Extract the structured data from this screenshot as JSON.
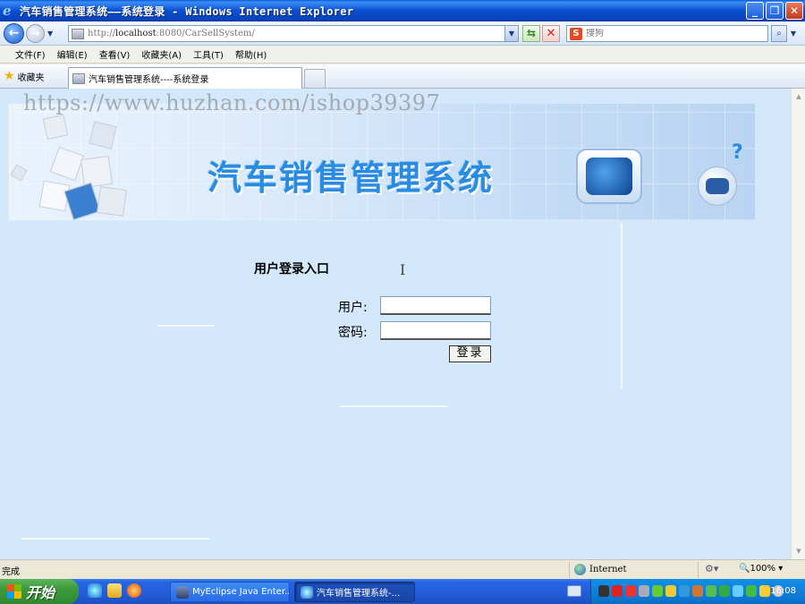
{
  "window": {
    "title": "汽车销售管理系统——系统登录 - Windows Internet Explorer",
    "ie_logo": "e"
  },
  "address_bar": {
    "url_prefix": "http://",
    "url_host": "localhost",
    "url_rest": ":8080/CarSellSystem/",
    "search_placeholder": "搜狗",
    "search_logo": "S"
  },
  "menu": {
    "items": [
      "文件(F)",
      "编辑(E)",
      "查看(V)",
      "收藏夹(A)",
      "工具(T)",
      "帮助(H)"
    ]
  },
  "favorites": {
    "label": "收藏夹"
  },
  "tab": {
    "title": "汽车销售管理系统----系统登录"
  },
  "page": {
    "watermark": "https://www.huzhan.com/ishop39397",
    "banner_title": "汽车销售管理系统",
    "question_mark": "?",
    "login_title": "用户登录入口",
    "user_label": "用户:",
    "password_label": "密码:",
    "user_value": "",
    "password_value": "",
    "login_button": "登录"
  },
  "status": {
    "text": "完成",
    "zone": "Internet",
    "zoom": "100%"
  },
  "taskbar": {
    "start_label": "开始",
    "tasks": [
      {
        "label": "MyEclipse Java Enter...",
        "active": false
      },
      {
        "label": "汽车销售管理系统-...",
        "active": true
      }
    ],
    "clock": "16:08"
  },
  "colors": {
    "page_background": "#d4e8fb",
    "banner_title": "#2a8be0",
    "titlebar": "#0a4fd0",
    "taskbar": "#245edb",
    "start_button": "#3c9a3c"
  }
}
